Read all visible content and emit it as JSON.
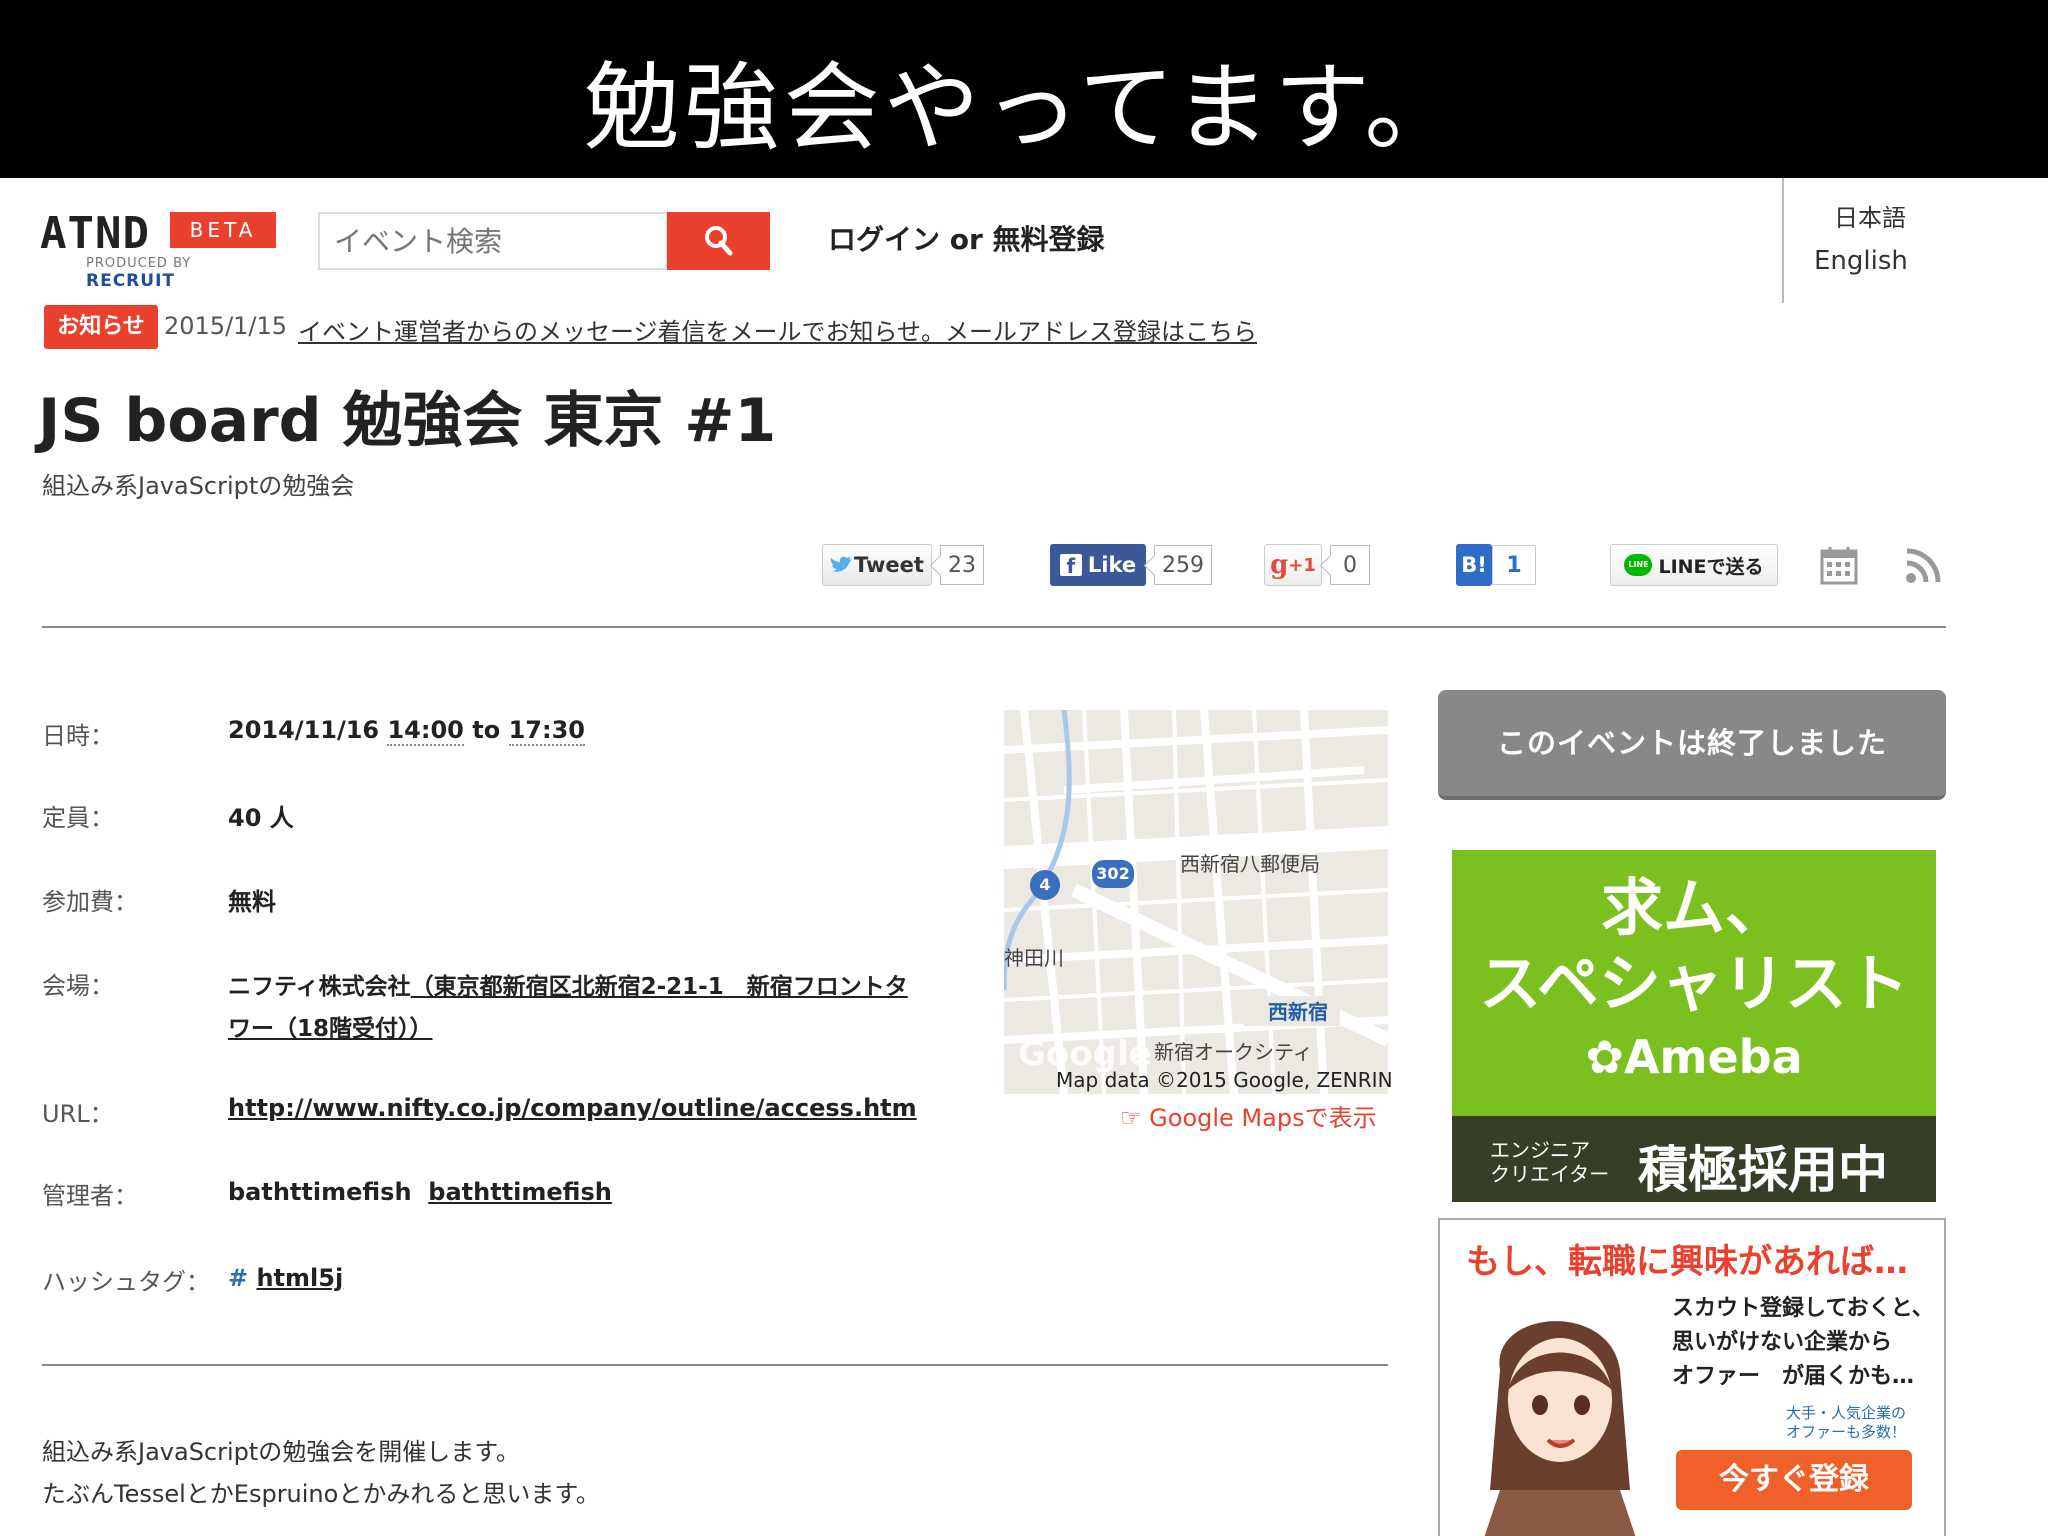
{
  "slide": {
    "title": "勉強会やってます。"
  },
  "header": {
    "logo_text": "ATND",
    "logo_badge": "BETA",
    "logo_produced": "PRODUCED BY",
    "logo_recruit": "RECRUIT",
    "search_placeholder": "イベント検索",
    "login_label": "ログイン or 無料登録",
    "lang_ja": "日本語",
    "lang_en": "English"
  },
  "notice": {
    "badge": "お知らせ",
    "date": "2015/1/15",
    "text": "イベント運営者からのメッセージ着信をメールでお知らせ。メールアドレス登録はこちら"
  },
  "event": {
    "title": "JS board 勉強会 東京 #1",
    "subtitle": "組込み系JavaScriptの勉強会"
  },
  "social": {
    "tweet_label": "Tweet",
    "tweet_count": "23",
    "like_label": "Like",
    "like_count": "259",
    "gplus_label": "+1",
    "gplus_count": "0",
    "hatena_label": "B!",
    "hatena_count": "1",
    "line_label": "LINEで送る"
  },
  "details": {
    "datetime_label": "日時：",
    "date": "2014/11/16",
    "time_start": "14:00",
    "to": "to",
    "time_end": "17:30",
    "capacity_label": "定員：",
    "capacity": "40 人",
    "fee_label": "参加費：",
    "fee": "無料",
    "venue_label": "会場：",
    "venue_name": "ニフティ株式会社",
    "venue_addr_1": "（東京都新宿区北新宿2-21-1　新宿フロントタ",
    "venue_addr_2": "ワー（18階受付））",
    "url_label": "URL：",
    "url": "http://www.nifty.co.jp/company/outline/access.htm",
    "admin_label": "管理者：",
    "admin_name": "bathttimefish",
    "admin_link": "bathttimefish",
    "hashtag_label": "ハッシュタグ：",
    "hashtag_symbol": "#",
    "hashtag": "html5j"
  },
  "map": {
    "label_post": "西新宿八郵便局",
    "label_river": "神田川",
    "label_station": "西新宿",
    "label_tower": "新宿オークシティ",
    "route_302": "302",
    "route_4": "4",
    "watermark": "Google",
    "attribution": "Map data ©2015 Google, ZENRIN",
    "link": "Google Mapsで表示"
  },
  "description": {
    "line1": "組込み系JavaScriptの勉強会を開催します。",
    "line2": "たぶんTesselとかEspruinoとかみれると思います。"
  },
  "sidebar": {
    "ended_label": "このイベントは終了しました",
    "ad1": {
      "title_1": "求ム、",
      "title_2": "スペシャリスト",
      "brand": "Ameba",
      "small_1": "エンジニア",
      "small_2": "クリエイター",
      "big": "積極採用中"
    },
    "ad2": {
      "headline": "もし、転職に興味があれば…",
      "text_1": "スカウト登録しておくと、",
      "text_2": "思いがけない企業から",
      "text_3": "オファー　が届くかも…",
      "note_1": "大手・人気企業の",
      "note_2": "オファーも多数！",
      "button": "今すぐ登録"
    }
  },
  "colors": {
    "accent": "#e9412e",
    "twitter": "#55acee",
    "facebook": "#3b5998",
    "line": "#00b900",
    "ameba_green": "#7cc01f"
  }
}
